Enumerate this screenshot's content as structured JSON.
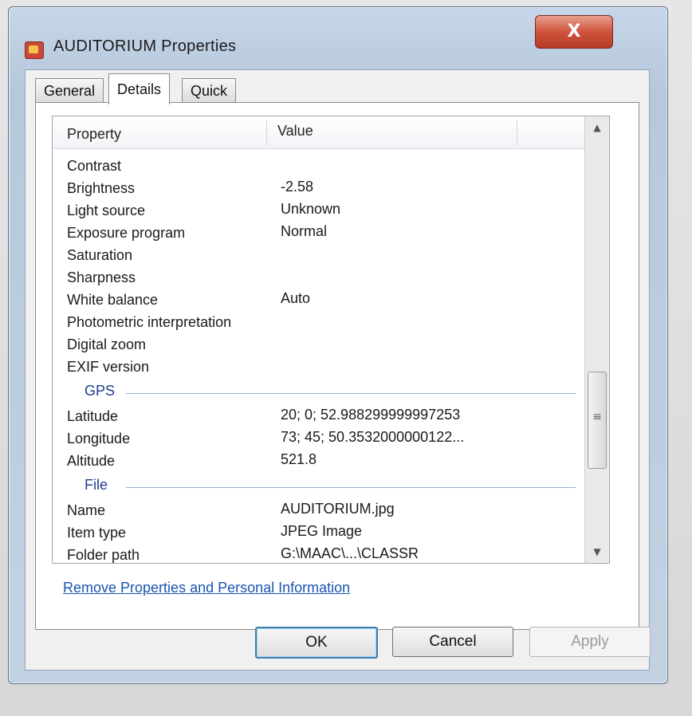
{
  "window": {
    "title": "AUDITORIUM Properties",
    "close_label": "X"
  },
  "tabs": [
    {
      "label": "General",
      "active": false
    },
    {
      "label": "Details",
      "active": true
    },
    {
      "label": "Quick Heal",
      "active": false
    }
  ],
  "list": {
    "columns": [
      "Property",
      "Value"
    ],
    "rows": [
      {
        "property": "Contrast",
        "value": ""
      },
      {
        "property": "Brightness",
        "value": "-2.58"
      },
      {
        "property": "Light source",
        "value": "Unknown"
      },
      {
        "property": "Exposure program",
        "value": "Normal"
      },
      {
        "property": "Saturation",
        "value": ""
      },
      {
        "property": "Sharpness",
        "value": ""
      },
      {
        "property": "White balance",
        "value": "Auto"
      },
      {
        "property": "Photometric interpretation",
        "value": ""
      },
      {
        "property": "Digital zoom",
        "value": ""
      },
      {
        "property": "EXIF version",
        "value": ""
      }
    ],
    "groups": [
      {
        "label": "GPS",
        "rows": [
          {
            "property": "Latitude",
            "value": "20; 0; 52.988299999997253"
          },
          {
            "property": "Longitude",
            "value": "73; 45; 50.3532000000122..."
          },
          {
            "property": "Altitude",
            "value": "521.8"
          }
        ]
      },
      {
        "label": "File",
        "rows": [
          {
            "property": "Name",
            "value": "AUDITORIUM.jpg"
          },
          {
            "property": "Item type",
            "value": "JPEG Image"
          },
          {
            "property": "Folder path",
            "value": "G:\\MAAC\\...\\CLASSR"
          }
        ]
      }
    ]
  },
  "scrollbar": {
    "up_icon": "▲",
    "down_icon": "▼",
    "grip_icon": "≡"
  },
  "remove_link": "Remove Properties and Personal Information",
  "buttons": {
    "ok": "OK",
    "cancel": "Cancel",
    "apply": "Apply"
  }
}
